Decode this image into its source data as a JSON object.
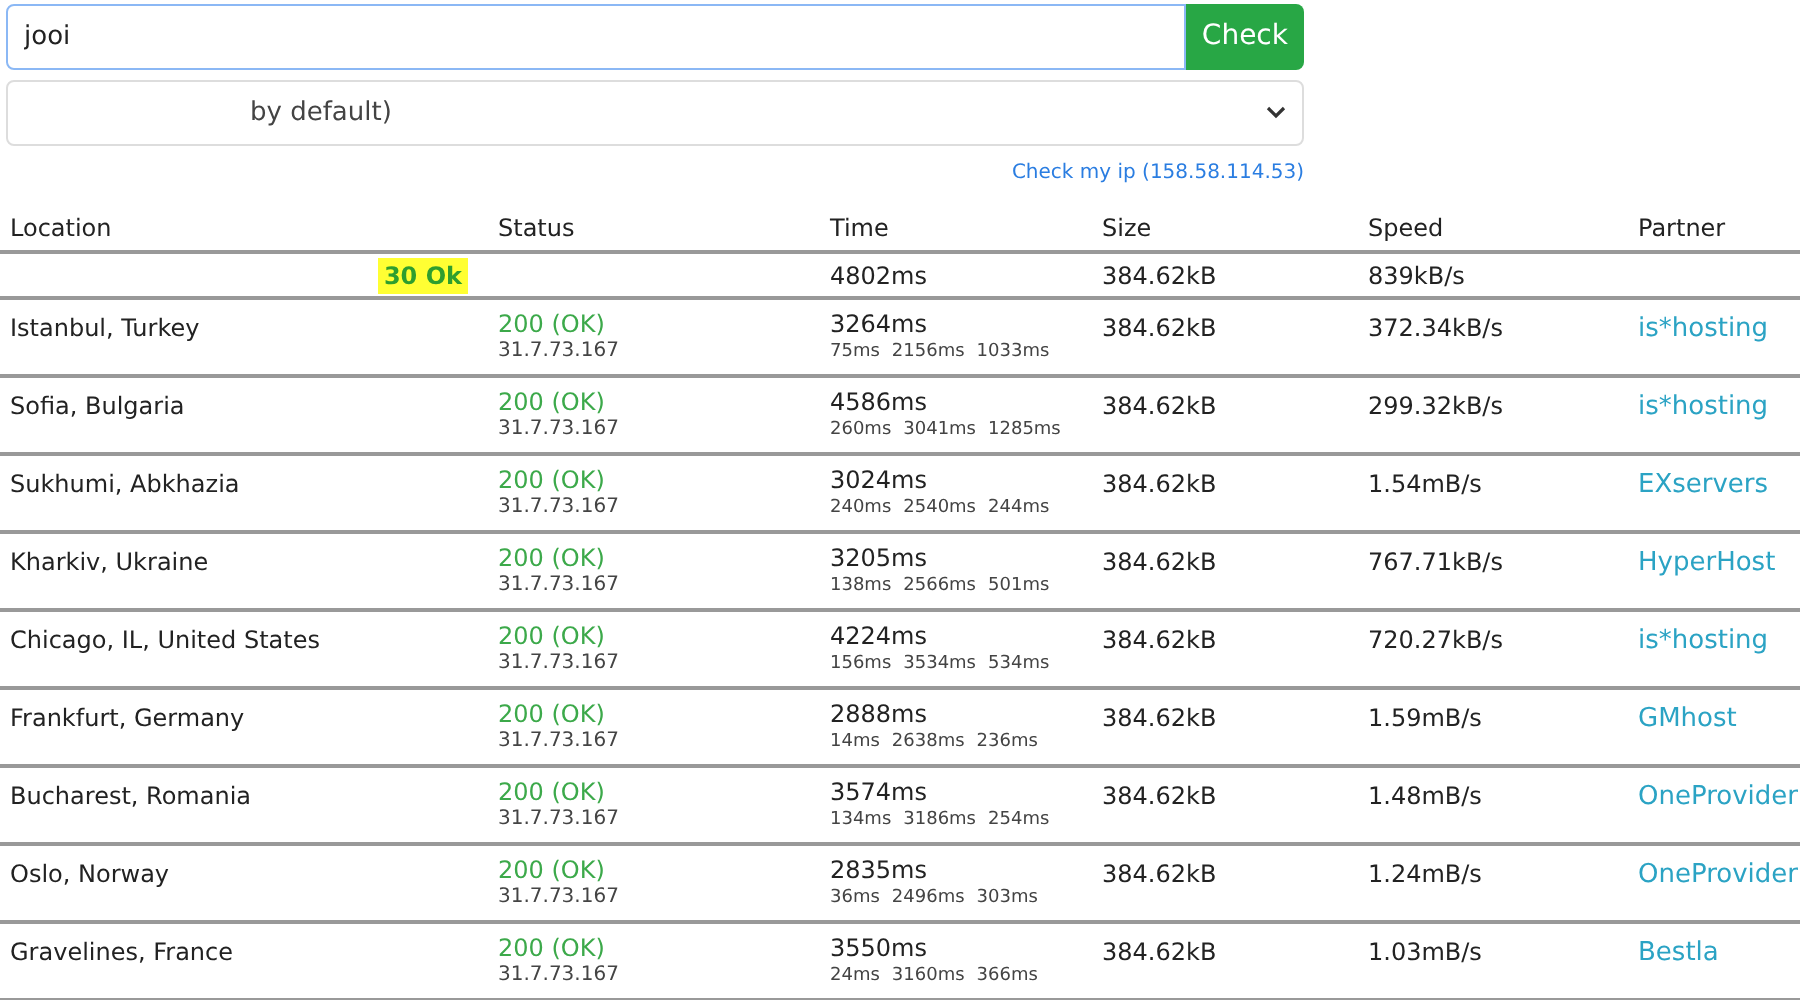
{
  "search": {
    "value": "jooi",
    "button": "Check"
  },
  "select": {
    "value": "by default)"
  },
  "check_ip_link": "Check my ip (158.58.114.53)",
  "table": {
    "columns": [
      "Location",
      "Status",
      "Time",
      "Size",
      "Speed",
      "Partner"
    ],
    "summary": {
      "ok_count": "30 Ok",
      "time": "4802ms",
      "size": "384.62kB",
      "speed": "839kB/s"
    },
    "rows": [
      {
        "location": "Istanbul, Turkey",
        "status": "200 (OK)",
        "ip": "31.7.73.167",
        "time": "3264ms",
        "timings": [
          "75ms",
          "2156ms",
          "1033ms"
        ],
        "size": "384.62kB",
        "speed": "372.34kB/s",
        "partner": "is*hosting"
      },
      {
        "location": "Sofia, Bulgaria",
        "status": "200 (OK)",
        "ip": "31.7.73.167",
        "time": "4586ms",
        "timings": [
          "260ms",
          "3041ms",
          "1285ms"
        ],
        "size": "384.62kB",
        "speed": "299.32kB/s",
        "partner": "is*hosting"
      },
      {
        "location": "Sukhumi, Abkhazia",
        "status": "200 (OK)",
        "ip": "31.7.73.167",
        "time": "3024ms",
        "timings": [
          "240ms",
          "2540ms",
          "244ms"
        ],
        "size": "384.62kB",
        "speed": "1.54mB/s",
        "partner": "EXservers"
      },
      {
        "location": "Kharkiv, Ukraine",
        "status": "200 (OK)",
        "ip": "31.7.73.167",
        "time": "3205ms",
        "timings": [
          "138ms",
          "2566ms",
          "501ms"
        ],
        "size": "384.62kB",
        "speed": "767.71kB/s",
        "partner": "HyperHost"
      },
      {
        "location": "Chicago, IL, United States",
        "status": "200 (OK)",
        "ip": "31.7.73.167",
        "time": "4224ms",
        "timings": [
          "156ms",
          "3534ms",
          "534ms"
        ],
        "size": "384.62kB",
        "speed": "720.27kB/s",
        "partner": "is*hosting"
      },
      {
        "location": "Frankfurt, Germany",
        "status": "200 (OK)",
        "ip": "31.7.73.167",
        "time": "2888ms",
        "timings": [
          "14ms",
          "2638ms",
          "236ms"
        ],
        "size": "384.62kB",
        "speed": "1.59mB/s",
        "partner": "GMhost"
      },
      {
        "location": "Bucharest, Romania",
        "status": "200 (OK)",
        "ip": "31.7.73.167",
        "time": "3574ms",
        "timings": [
          "134ms",
          "3186ms",
          "254ms"
        ],
        "size": "384.62kB",
        "speed": "1.48mB/s",
        "partner": "OneProvider"
      },
      {
        "location": "Oslo, Norway",
        "status": "200 (OK)",
        "ip": "31.7.73.167",
        "time": "2835ms",
        "timings": [
          "36ms",
          "2496ms",
          "303ms"
        ],
        "size": "384.62kB",
        "speed": "1.24mB/s",
        "partner": "OneProvider"
      },
      {
        "location": "Gravelines, France",
        "status": "200 (OK)",
        "ip": "31.7.73.167",
        "time": "3550ms",
        "timings": [
          "24ms",
          "3160ms",
          "366ms"
        ],
        "size": "384.62kB",
        "speed": "1.03mB/s",
        "partner": "Bestla"
      }
    ]
  }
}
